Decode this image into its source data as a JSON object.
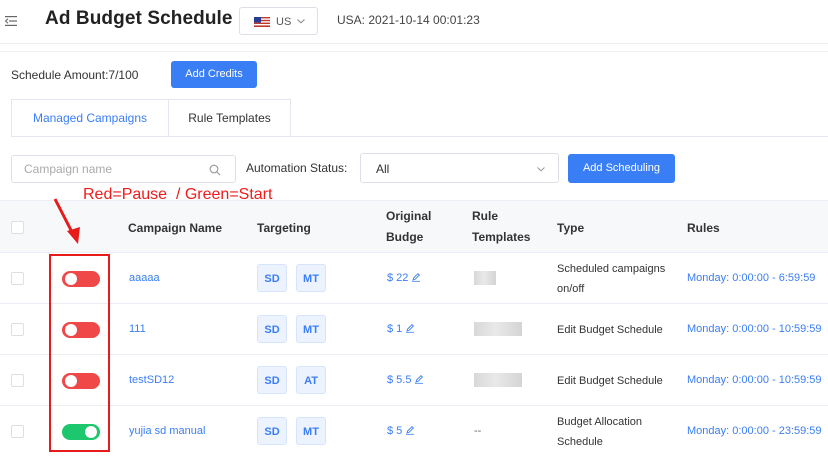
{
  "header": {
    "title": "Ad Budget Schedule",
    "country": "US",
    "timestamp": "USA: 2021-10-14 00:01:23"
  },
  "schedule": {
    "amount_label": "Schedule Amount:7/100",
    "add_credits_label": "Add Credits"
  },
  "tabs": [
    {
      "label": "Managed Campaigns",
      "active": true
    },
    {
      "label": "Rule Templates",
      "active": false
    }
  ],
  "filters": {
    "search_placeholder": "Campaign name",
    "automation_status_label": "Automation Status:",
    "automation_status_value": "All",
    "add_scheduling_label": "Add Scheduling"
  },
  "annotation": {
    "text": "Red=Pause  / Green=Start",
    "color": "#ee1c1c"
  },
  "table": {
    "columns": {
      "campaign_name": "Campaign Name",
      "targeting": "Targeting",
      "original_budget": "Original Budge",
      "rule_templates": "Rule Templates",
      "type": "Type",
      "rules": "Rules"
    },
    "rows": [
      {
        "enabled": false,
        "name": "aaaaa",
        "targeting": [
          "SD",
          "MT"
        ],
        "budget": "$ 22",
        "rule_template": "",
        "type": "Scheduled campaigns on/off",
        "rules": "Monday:   0:00:00 - 6:59:59"
      },
      {
        "enabled": false,
        "name": "111",
        "targeting": [
          "SD",
          "MT"
        ],
        "budget": "$ 1",
        "rule_template": "",
        "type": "Edit Budget Schedule",
        "rules": "Monday:   0:00:00 - 10:59:59"
      },
      {
        "enabled": false,
        "name": "testSD12",
        "targeting": [
          "SD",
          "AT"
        ],
        "budget": "$ 5.5",
        "rule_template": "",
        "type": "Edit Budget Schedule",
        "rules": "Monday:   0:00:00 - 10:59:59"
      },
      {
        "enabled": true,
        "name": "yujia sd manual",
        "targeting": [
          "SD",
          "MT"
        ],
        "budget": "$ 5",
        "rule_template": "--",
        "type": "Budget Allocation Schedule",
        "rules": "Monday:   0:00:00 - 23:59:59"
      }
    ]
  },
  "colors": {
    "accent": "#3a7ef6",
    "toggle_on": "#1dc76e",
    "toggle_off": "#f04848"
  }
}
